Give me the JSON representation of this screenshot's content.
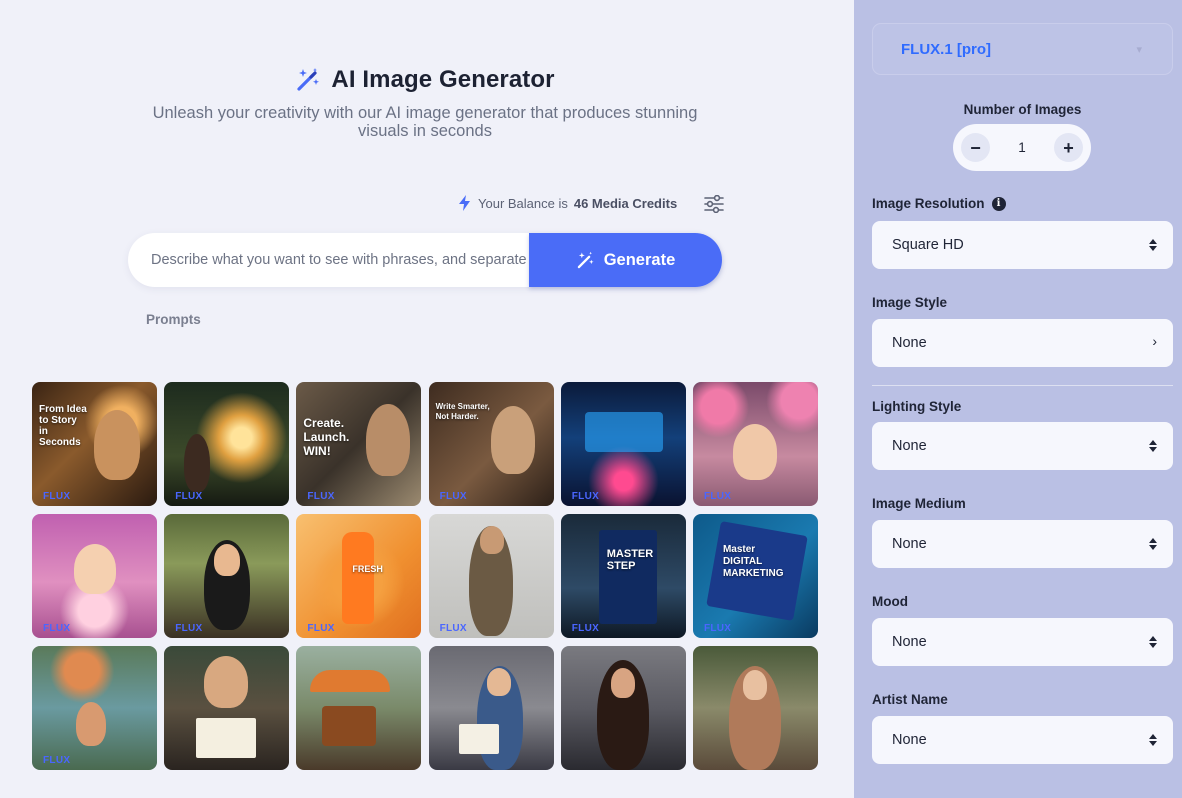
{
  "header": {
    "title": "AI Image Generator",
    "subtitle": "Unleash your creativity with our AI image generator that produces stunning visuals in seconds"
  },
  "balance": {
    "prefix": "Your Balance is",
    "credits": "46 Media Credits"
  },
  "prompt": {
    "placeholder": "Describe what you want to see with phrases, and separate them with commas",
    "generate_label": "Generate"
  },
  "prompts_label": "Prompts",
  "gallery": {
    "badge": "FLUX",
    "tiles": [
      {
        "caption": "From Idea\nto Story\nin\nSeconds"
      },
      {
        "caption": ""
      },
      {
        "caption": "Create.\nLaunch.\nWIN!"
      },
      {
        "caption": "Write Smarter,\nNot Harder."
      },
      {
        "caption": ""
      },
      {
        "caption": ""
      },
      {
        "caption": ""
      },
      {
        "caption": ""
      },
      {
        "caption": "FRESH"
      },
      {
        "caption": ""
      },
      {
        "caption": "MASTER\nSTEP"
      },
      {
        "caption": "Master\nDIGITAL\nMARKETING"
      },
      {
        "caption": ""
      },
      {
        "caption": ""
      },
      {
        "caption": ""
      },
      {
        "caption": ""
      },
      {
        "caption": ""
      },
      {
        "caption": ""
      }
    ]
  },
  "sidebar": {
    "model": "FLUX.1 [pro]",
    "num_images_label": "Number of Images",
    "num_images_value": "1",
    "minus": "−",
    "plus": "+",
    "resolution_label": "Image Resolution",
    "resolution_value": "Square HD",
    "style_label": "Image Style",
    "style_value": "None",
    "lighting_label": "Lighting Style",
    "lighting_value": "None",
    "medium_label": "Image Medium",
    "medium_value": "None",
    "mood_label": "Mood",
    "mood_value": "None",
    "artist_label": "Artist Name",
    "artist_value": "None"
  },
  "colors": {
    "accent": "#4a6cf7",
    "sidebar_bg": "#bac0e4",
    "main_bg": "#f0f1f9",
    "model_text": "#2f6bff"
  }
}
